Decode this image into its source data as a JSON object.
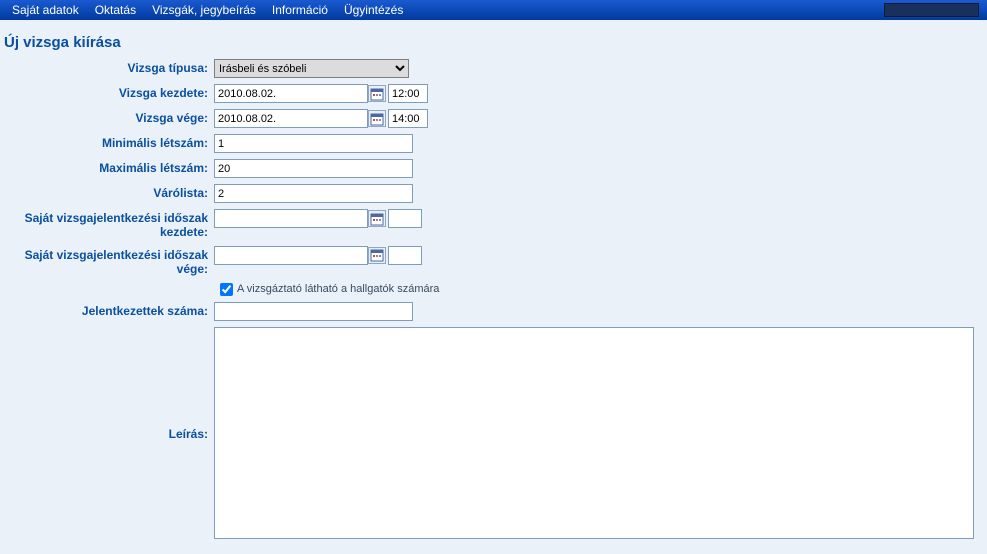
{
  "menu": {
    "items": [
      "Saját adatok",
      "Oktatás",
      "Vizsgák, jegybeírás",
      "Információ",
      "Ügyintézés"
    ]
  },
  "page": {
    "title": "Új vizsga kiírása"
  },
  "form": {
    "type_label": "Vizsga típusa:",
    "type_value": "Irásbeli és szóbeli",
    "start_label": "Vizsga kezdete:",
    "start_date": "2010.08.02.",
    "start_time": "12:00",
    "end_label": "Vizsga vége:",
    "end_date": "2010.08.02.",
    "end_time": "14:00",
    "min_label": "Minimális létszám:",
    "min_value": "1",
    "max_label": "Maximális létszám:",
    "max_value": "20",
    "wait_label": "Várólista:",
    "wait_value": "2",
    "own_period_start_label": "Saját vizsgajelentkezési időszak kezdete:",
    "own_period_start_date": "",
    "own_period_start_time": "",
    "own_period_end_label": "Saját vizsgajelentkezési időszak vége:",
    "own_period_end_date": "",
    "own_period_end_time": "",
    "visible_checkbox_label": "A vizsgáztató látható a hallgatók számára",
    "applicants_label": "Jelentkezettek száma:",
    "applicants_value": "",
    "desc_label": "Leírás:",
    "desc_value": ""
  }
}
